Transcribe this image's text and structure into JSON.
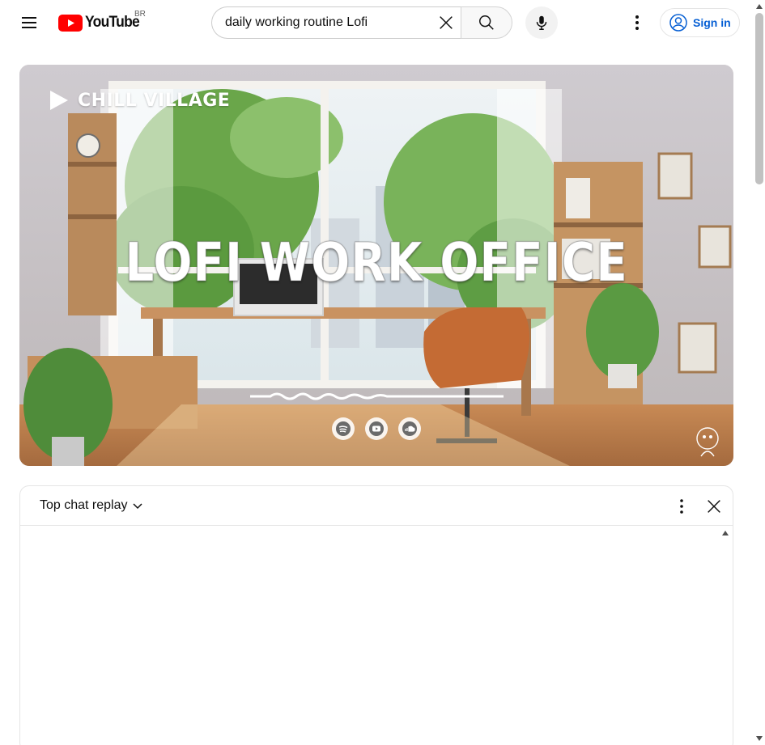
{
  "masthead": {
    "menu_icon": "hamburger-menu-icon",
    "logo_text": "YouTube",
    "country_code": "BR",
    "search": {
      "value": "daily working routine Lofi",
      "placeholder": "Search",
      "clear_icon": "close-icon",
      "submit_icon": "search-icon"
    },
    "voice_icon": "microphone-icon",
    "settings_icon": "more-vert-icon",
    "sign_in": {
      "label": "Sign in",
      "icon": "account-circle-icon"
    }
  },
  "player": {
    "thumbnail": {
      "channel_name": "CHILL VILLAGE",
      "title": "LOFI WORK OFFICE",
      "social_icons": [
        "spotify-icon",
        "youtube-icon",
        "soundcloud-icon"
      ]
    }
  },
  "chat": {
    "mode_label": "Top chat replay",
    "mode_icon": "chevron-down-icon",
    "more_icon": "more-vert-icon",
    "close_icon": "close-icon"
  },
  "colors": {
    "brand_red": "#ff0000",
    "link_blue": "#065fd4",
    "text_primary": "#0f0f0f",
    "border": "#e5e5e5"
  }
}
